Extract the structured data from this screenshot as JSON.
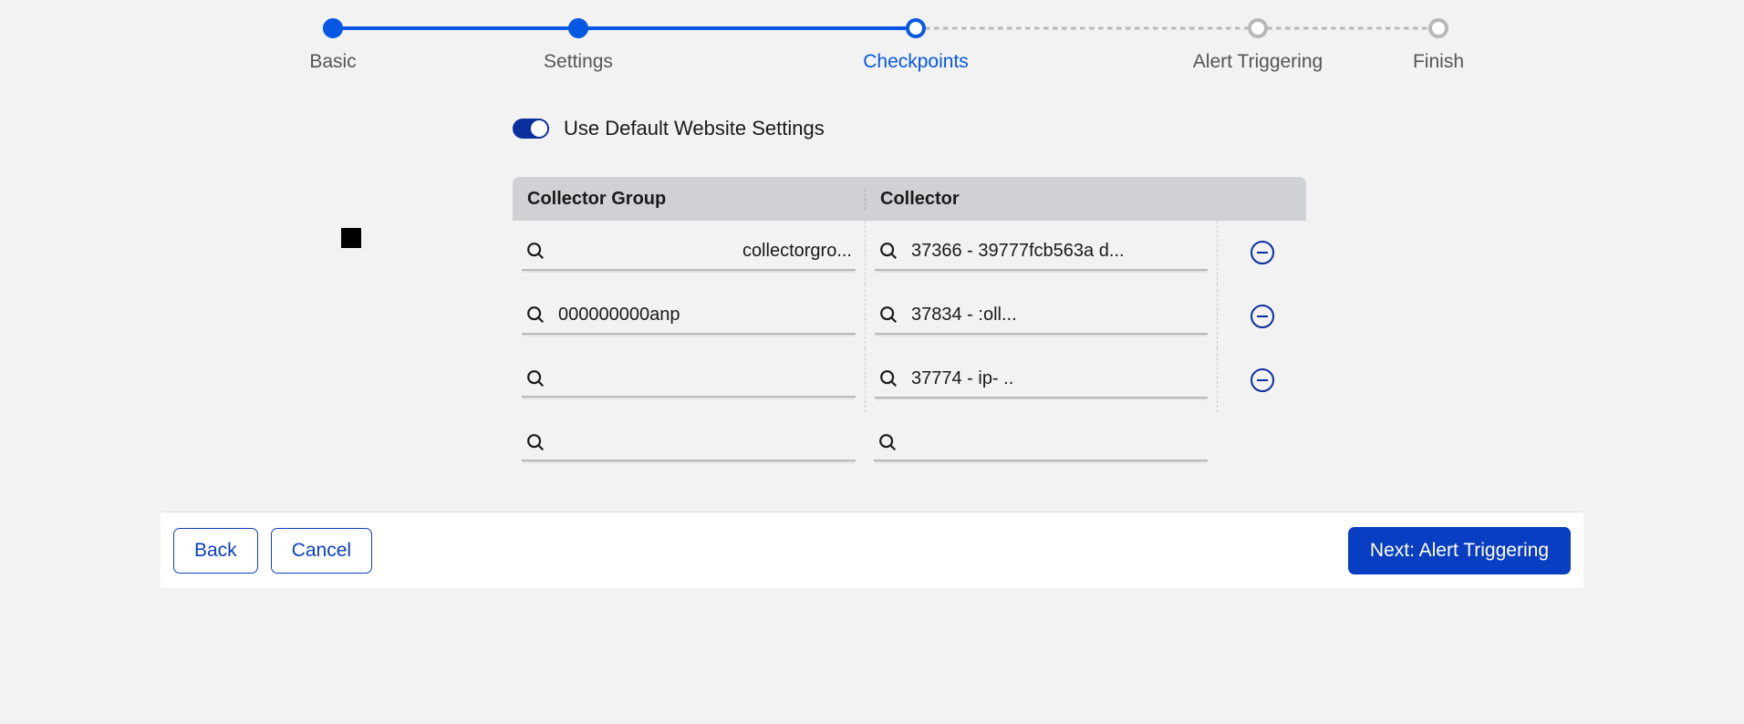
{
  "stepper": {
    "steps": [
      {
        "label": "Basic"
      },
      {
        "label": "Settings"
      },
      {
        "label": "Checkpoints"
      },
      {
        "label": "Alert Triggering"
      },
      {
        "label": "Finish"
      }
    ]
  },
  "toggle": {
    "label": "Use Default Website Settings"
  },
  "table": {
    "headers": {
      "group": "Collector Group",
      "collector": "Collector"
    },
    "rows": [
      {
        "group": "collectorgro...",
        "group_align": "right",
        "collector": "37366 - 39777fcb563a d...",
        "removable": true
      },
      {
        "group": "000000000anp",
        "group_align": "left",
        "collector": "37834 -                       :oll...",
        "removable": true
      },
      {
        "group": "",
        "group_align": "left",
        "collector": "37774 - ip-                        ..",
        "removable": true
      },
      {
        "group": "",
        "group_align": "left",
        "collector": "",
        "removable": false
      }
    ]
  },
  "footer": {
    "back": "Back",
    "cancel": "Cancel",
    "next": "Next: Alert Triggering"
  }
}
